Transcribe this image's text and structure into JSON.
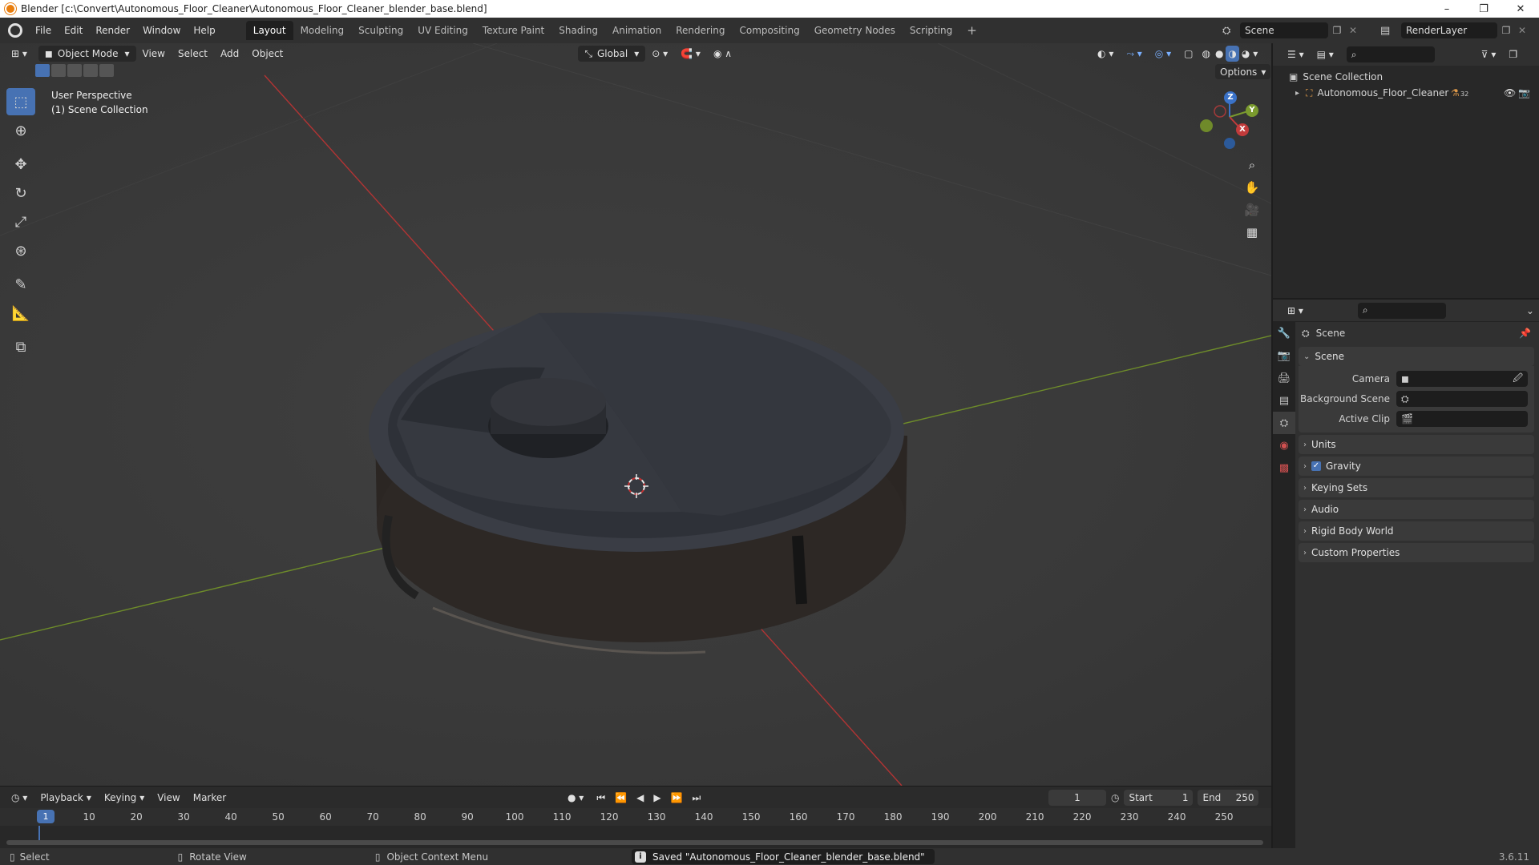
{
  "window": {
    "title": "Blender [c:\\Convert\\Autonomous_Floor_Cleaner\\Autonomous_Floor_Cleaner_blender_base.blend]",
    "min": "–",
    "max": "❐",
    "close": "✕"
  },
  "menubar": {
    "menus": [
      "File",
      "Edit",
      "Render",
      "Window",
      "Help"
    ],
    "workspaces": [
      "Layout",
      "Modeling",
      "Sculpting",
      "UV Editing",
      "Texture Paint",
      "Shading",
      "Animation",
      "Rendering",
      "Compositing",
      "Geometry Nodes",
      "Scripting"
    ],
    "active_workspace": "Layout",
    "add_workspace": "+",
    "scene_name": "Scene",
    "view_layer": "RenderLayer"
  },
  "viewport": {
    "mode": "Object Mode",
    "menus": [
      "View",
      "Select",
      "Add",
      "Object"
    ],
    "transform_orientation": "Global",
    "options": "Options",
    "overlay_line1": "User Perspective",
    "overlay_line2": "(1) Scene Collection",
    "gizmo": {
      "z": "Z",
      "y": "Y",
      "x": "X"
    }
  },
  "outliner": {
    "root": "Scene Collection",
    "object": "Autonomous_Floor_Cleaner",
    "modifier_count": "32"
  },
  "properties": {
    "context": "Scene",
    "panel_scene": "Scene",
    "rows": [
      {
        "label": "Camera",
        "value": ""
      },
      {
        "label": "Background Scene",
        "value": ""
      },
      {
        "label": "Active Clip",
        "value": ""
      }
    ],
    "panels": [
      "Units",
      "Gravity",
      "Keying Sets",
      "Audio",
      "Rigid Body World",
      "Custom Properties"
    ],
    "gravity_checked": true
  },
  "timeline": {
    "menus": [
      "Playback",
      "Keying",
      "View",
      "Marker"
    ],
    "current_frame": "1",
    "start_label": "Start",
    "start": "1",
    "end_label": "End",
    "end": "250",
    "ruler": [
      "10",
      "20",
      "30",
      "40",
      "50",
      "60",
      "70",
      "80",
      "90",
      "100",
      "110",
      "120",
      "130",
      "140",
      "150",
      "160",
      "170",
      "180",
      "190",
      "200",
      "210",
      "220",
      "230",
      "240",
      "250"
    ],
    "playhead": "1"
  },
  "status": {
    "select": "Select",
    "rotate": "Rotate View",
    "context_menu": "Object Context Menu",
    "message": "Saved \"Autonomous_Floor_Cleaner_blender_base.blend\"",
    "version": "3.6.11"
  },
  "colors": {
    "accent": "#4772b3",
    "x_axis": "#c23b3b",
    "y_axis": "#7a9a2e",
    "z_axis": "#3a72c8"
  }
}
